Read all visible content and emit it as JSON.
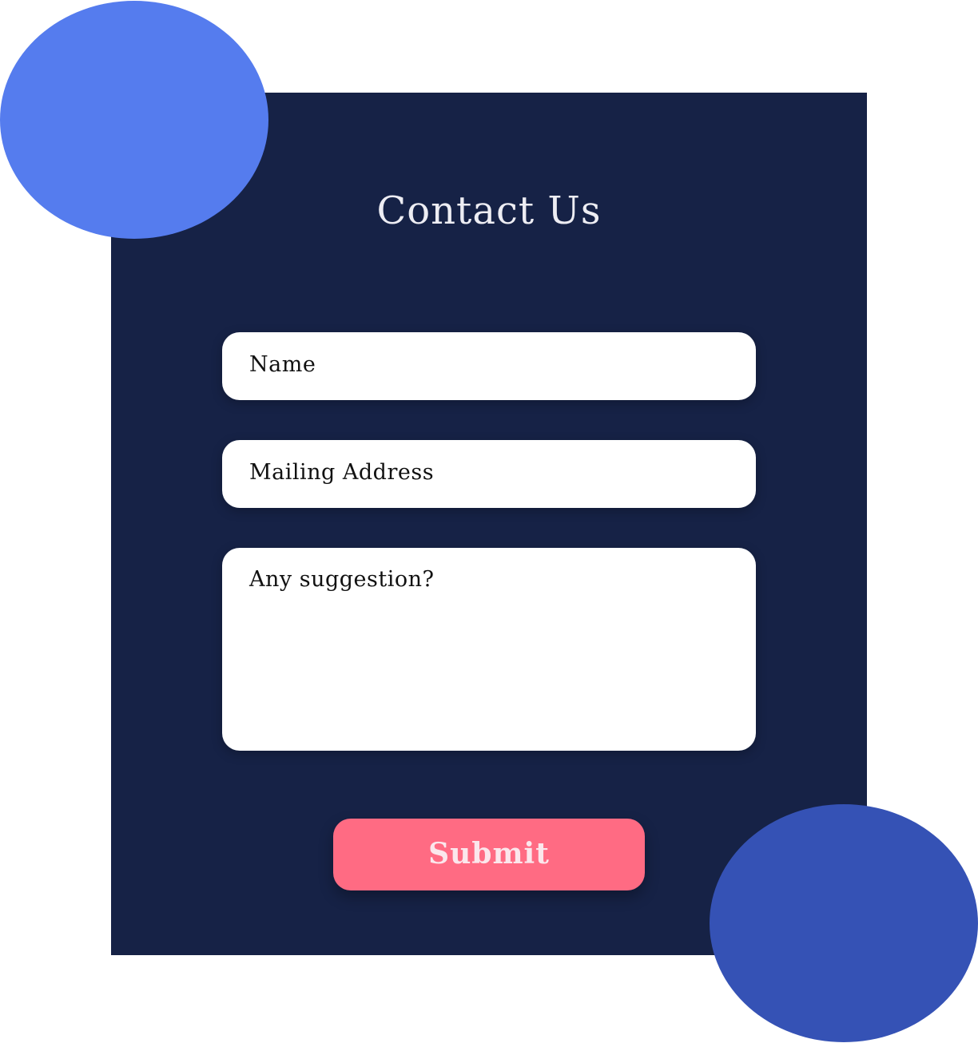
{
  "form": {
    "title": "Contact Us",
    "fields": {
      "name": {
        "placeholder": "Name"
      },
      "mailing_address": {
        "placeholder": "Mailing Address"
      },
      "suggestion": {
        "placeholder": "Any suggestion?"
      }
    },
    "submit_label": "Submit"
  },
  "colors": {
    "panel_background": "#162246",
    "blob_top": "#557CEE",
    "blob_bottom": "#3552B5",
    "submit_button": "#FF6B83",
    "field_background": "#FFFFFF",
    "page_background": "#FFFFFF"
  }
}
